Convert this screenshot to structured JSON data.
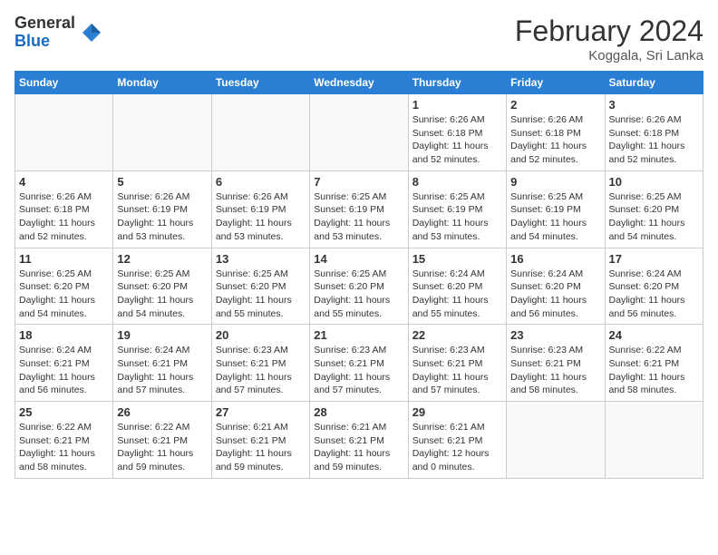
{
  "header": {
    "logo": {
      "general": "General",
      "blue": "Blue"
    },
    "title": "February 2024",
    "location": "Koggala, Sri Lanka"
  },
  "weekdays": [
    "Sunday",
    "Monday",
    "Tuesday",
    "Wednesday",
    "Thursday",
    "Friday",
    "Saturday"
  ],
  "weeks": [
    [
      {
        "day": "",
        "info": ""
      },
      {
        "day": "",
        "info": ""
      },
      {
        "day": "",
        "info": ""
      },
      {
        "day": "",
        "info": ""
      },
      {
        "day": "1",
        "info": "Sunrise: 6:26 AM\nSunset: 6:18 PM\nDaylight: 11 hours and 52 minutes."
      },
      {
        "day": "2",
        "info": "Sunrise: 6:26 AM\nSunset: 6:18 PM\nDaylight: 11 hours and 52 minutes."
      },
      {
        "day": "3",
        "info": "Sunrise: 6:26 AM\nSunset: 6:18 PM\nDaylight: 11 hours and 52 minutes."
      }
    ],
    [
      {
        "day": "4",
        "info": "Sunrise: 6:26 AM\nSunset: 6:18 PM\nDaylight: 11 hours and 52 minutes."
      },
      {
        "day": "5",
        "info": "Sunrise: 6:26 AM\nSunset: 6:19 PM\nDaylight: 11 hours and 53 minutes."
      },
      {
        "day": "6",
        "info": "Sunrise: 6:26 AM\nSunset: 6:19 PM\nDaylight: 11 hours and 53 minutes."
      },
      {
        "day": "7",
        "info": "Sunrise: 6:25 AM\nSunset: 6:19 PM\nDaylight: 11 hours and 53 minutes."
      },
      {
        "day": "8",
        "info": "Sunrise: 6:25 AM\nSunset: 6:19 PM\nDaylight: 11 hours and 53 minutes."
      },
      {
        "day": "9",
        "info": "Sunrise: 6:25 AM\nSunset: 6:19 PM\nDaylight: 11 hours and 54 minutes."
      },
      {
        "day": "10",
        "info": "Sunrise: 6:25 AM\nSunset: 6:20 PM\nDaylight: 11 hours and 54 minutes."
      }
    ],
    [
      {
        "day": "11",
        "info": "Sunrise: 6:25 AM\nSunset: 6:20 PM\nDaylight: 11 hours and 54 minutes."
      },
      {
        "day": "12",
        "info": "Sunrise: 6:25 AM\nSunset: 6:20 PM\nDaylight: 11 hours and 54 minutes."
      },
      {
        "day": "13",
        "info": "Sunrise: 6:25 AM\nSunset: 6:20 PM\nDaylight: 11 hours and 55 minutes."
      },
      {
        "day": "14",
        "info": "Sunrise: 6:25 AM\nSunset: 6:20 PM\nDaylight: 11 hours and 55 minutes."
      },
      {
        "day": "15",
        "info": "Sunrise: 6:24 AM\nSunset: 6:20 PM\nDaylight: 11 hours and 55 minutes."
      },
      {
        "day": "16",
        "info": "Sunrise: 6:24 AM\nSunset: 6:20 PM\nDaylight: 11 hours and 56 minutes."
      },
      {
        "day": "17",
        "info": "Sunrise: 6:24 AM\nSunset: 6:20 PM\nDaylight: 11 hours and 56 minutes."
      }
    ],
    [
      {
        "day": "18",
        "info": "Sunrise: 6:24 AM\nSunset: 6:21 PM\nDaylight: 11 hours and 56 minutes."
      },
      {
        "day": "19",
        "info": "Sunrise: 6:24 AM\nSunset: 6:21 PM\nDaylight: 11 hours and 57 minutes."
      },
      {
        "day": "20",
        "info": "Sunrise: 6:23 AM\nSunset: 6:21 PM\nDaylight: 11 hours and 57 minutes."
      },
      {
        "day": "21",
        "info": "Sunrise: 6:23 AM\nSunset: 6:21 PM\nDaylight: 11 hours and 57 minutes."
      },
      {
        "day": "22",
        "info": "Sunrise: 6:23 AM\nSunset: 6:21 PM\nDaylight: 11 hours and 57 minutes."
      },
      {
        "day": "23",
        "info": "Sunrise: 6:23 AM\nSunset: 6:21 PM\nDaylight: 11 hours and 58 minutes."
      },
      {
        "day": "24",
        "info": "Sunrise: 6:22 AM\nSunset: 6:21 PM\nDaylight: 11 hours and 58 minutes."
      }
    ],
    [
      {
        "day": "25",
        "info": "Sunrise: 6:22 AM\nSunset: 6:21 PM\nDaylight: 11 hours and 58 minutes."
      },
      {
        "day": "26",
        "info": "Sunrise: 6:22 AM\nSunset: 6:21 PM\nDaylight: 11 hours and 59 minutes."
      },
      {
        "day": "27",
        "info": "Sunrise: 6:21 AM\nSunset: 6:21 PM\nDaylight: 11 hours and 59 minutes."
      },
      {
        "day": "28",
        "info": "Sunrise: 6:21 AM\nSunset: 6:21 PM\nDaylight: 11 hours and 59 minutes."
      },
      {
        "day": "29",
        "info": "Sunrise: 6:21 AM\nSunset: 6:21 PM\nDaylight: 12 hours and 0 minutes."
      },
      {
        "day": "",
        "info": ""
      },
      {
        "day": "",
        "info": ""
      }
    ]
  ]
}
